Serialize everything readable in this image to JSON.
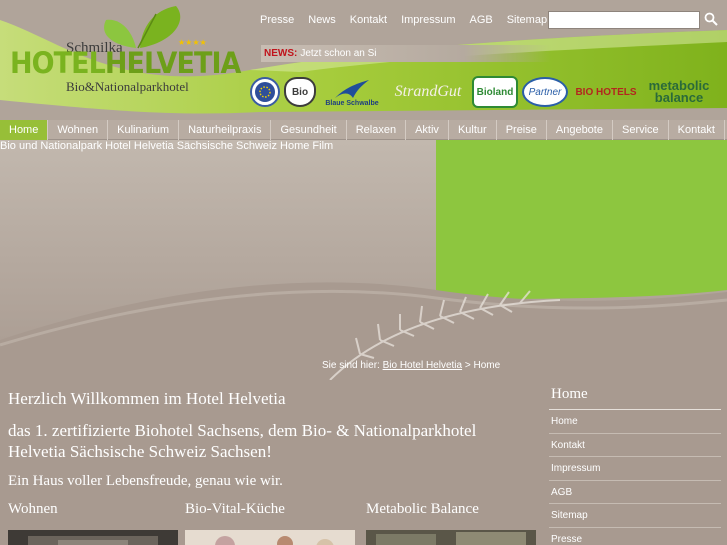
{
  "header": {
    "logo": {
      "pre": "Schmilka",
      "main_1": "HOTEL",
      "main_2": "HELVETIA",
      "stars": "★★★★",
      "sub": "Bio&Nationalparkhotel"
    },
    "top_nav": [
      "Presse",
      "News",
      "Kontakt",
      "Impressum",
      "AGB",
      "Sitemap"
    ],
    "search": {
      "value": "",
      "placeholder": ""
    },
    "news": {
      "label": "NEWS:",
      "text": "Jetzt schon an Si"
    },
    "partners": {
      "blaue_schwalbe": "Blaue Schwalbe",
      "bio": "Bio",
      "strandgut": "StrandGut",
      "bioland": "Bioland",
      "partner": "Partner",
      "biohotels": "BIO HOTELS",
      "metabolic_1": "metabolic",
      "metabolic_2": "balance"
    }
  },
  "main_nav": {
    "items": [
      "Home",
      "Wohnen",
      "Kulinarium",
      "Naturheilpraxis",
      "Gesundheit",
      "Relaxen",
      "Aktiv",
      "Kultur",
      "Preise",
      "Angebote",
      "Service",
      "Kontakt"
    ],
    "active": "Home"
  },
  "hero": {
    "alt_text": "Bio und Nationalpark Hotel Helvetia Sächsische Schweiz Home Film"
  },
  "breadcrumb": {
    "prefix": "Sie sind hier:",
    "link": "Bio Hotel Helvetia",
    "separator": ">",
    "current": "Home"
  },
  "content": {
    "welcome": "Herzlich Willkommen im Hotel Helvetia",
    "intro": "das 1. zertifizierte Biohotel Sachsens, dem Bio- & Nationalparkhotel Helvetia Sächsische Schweiz Sachsen!",
    "slogan": "Ein Haus voller Lebensfreude, genau wie wir.",
    "teasers": [
      "Wohnen",
      "Bio-Vital-Küche",
      "Metabolic Balance"
    ]
  },
  "sidebar": {
    "title": "Home",
    "items": [
      "Home",
      "Kontakt",
      "Impressum",
      "AGB",
      "Sitemap",
      "Presse"
    ]
  },
  "colors": {
    "accent_green": "#8dc63f",
    "background_taupe": "#a89a90",
    "news_red": "#c0141c"
  }
}
